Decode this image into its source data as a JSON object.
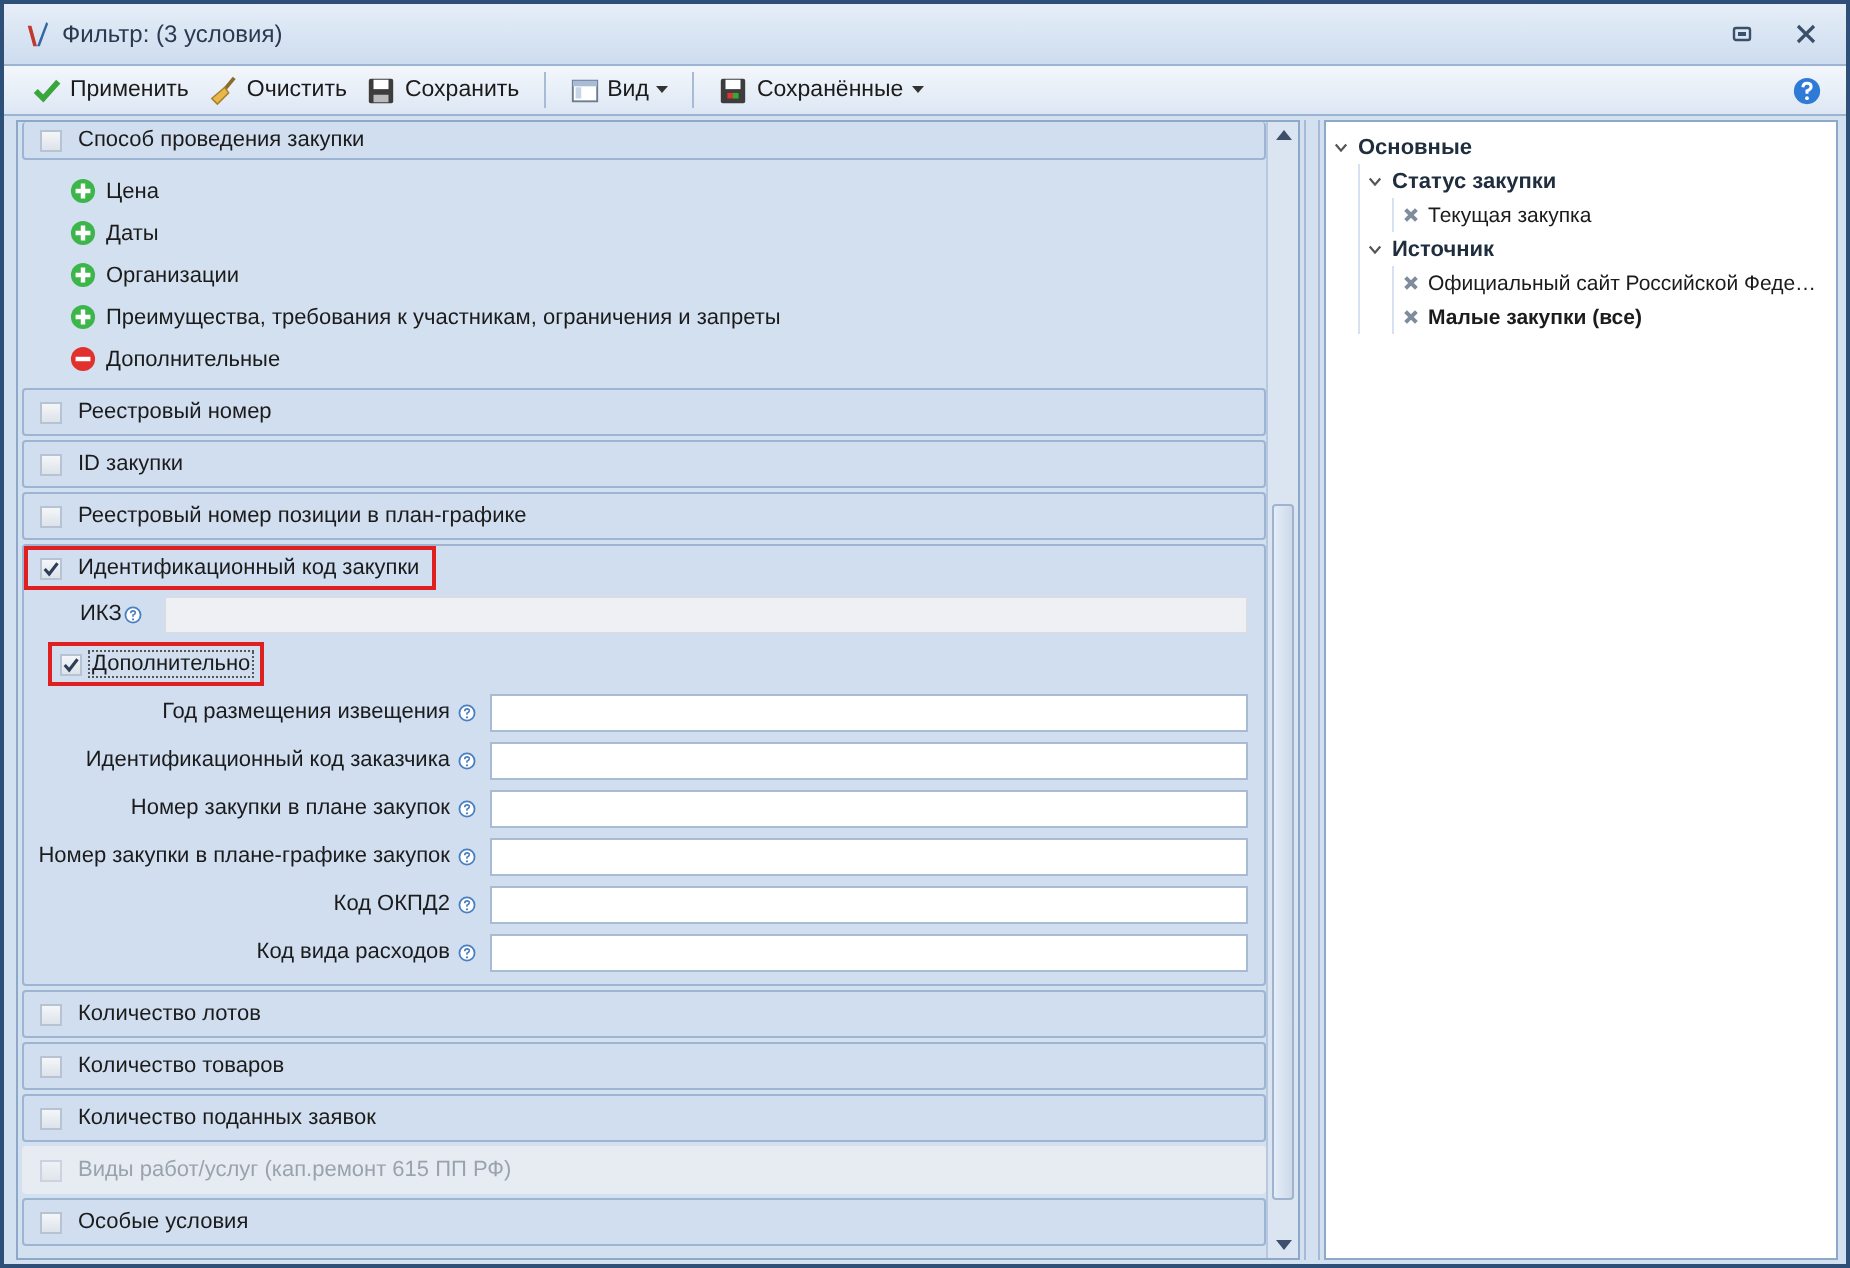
{
  "window": {
    "title": "Фильтр: (3 условия)"
  },
  "toolbar": [
    {
      "label": "Применить",
      "kind": "apply",
      "dropdown": false
    },
    {
      "label": "Очистить",
      "kind": "clear",
      "dropdown": false
    },
    {
      "label": "Сохранить",
      "kind": "save",
      "dropdown": false
    },
    {
      "label": "Вид",
      "kind": "view",
      "dropdown": true
    },
    {
      "label": "Сохранённые",
      "kind": "saved",
      "dropdown": true
    }
  ],
  "filters": [
    {
      "kind": "section",
      "label": "Способ проведения закупки",
      "checked": false,
      "disabled": false,
      "highlighted": false
    },
    {
      "kind": "groups",
      "groups": [
        {
          "label": "Цена",
          "expanded": false
        },
        {
          "label": "Даты",
          "expanded": false
        },
        {
          "label": "Организации",
          "expanded": false
        },
        {
          "label": "Преимущества, требования к участникам, ограничения и запреты",
          "expanded": false
        },
        {
          "label": "Дополнительные",
          "expanded": true
        }
      ]
    },
    {
      "kind": "section",
      "label": "Реестровый номер",
      "checked": false,
      "disabled": false,
      "highlighted": false
    },
    {
      "kind": "section",
      "label": "ID закупки",
      "checked": false,
      "disabled": false,
      "highlighted": false
    },
    {
      "kind": "section",
      "label": "Реестровый номер позиции в план-графике",
      "checked": false,
      "disabled": false,
      "highlighted": false
    },
    {
      "kind": "section",
      "label": "Идентификационный код закупки",
      "checked": true,
      "disabled": false,
      "highlighted": true,
      "main_field": {
        "label": "ИКЗ"
      },
      "extra": {
        "label": "Дополнительно",
        "checked": true,
        "highlighted": true
      },
      "fields": [
        {
          "label": "Год размещения извещения"
        },
        {
          "label": "Идентификационный код заказчика"
        },
        {
          "label": "Номер закупки в плане закупок"
        },
        {
          "label": "Номер закупки в плане-графике закупок"
        },
        {
          "label": "Код ОКПД2"
        },
        {
          "label": "Код вида расходов"
        }
      ]
    },
    {
      "kind": "section",
      "label": "Количество лотов",
      "checked": false,
      "disabled": false,
      "highlighted": false
    },
    {
      "kind": "section",
      "label": "Количество товаров",
      "checked": false,
      "disabled": false,
      "highlighted": false
    },
    {
      "kind": "section",
      "label": "Количество поданных заявок",
      "checked": false,
      "disabled": false,
      "highlighted": false
    },
    {
      "kind": "section",
      "label": "Виды работ/услуг (кап.ремонт 615 ПП РФ)",
      "checked": false,
      "disabled": true,
      "highlighted": false
    },
    {
      "kind": "section",
      "label": "Особые условия",
      "checked": false,
      "disabled": false,
      "highlighted": false
    }
  ],
  "summary": [
    {
      "label": "Основные",
      "expanded": true,
      "children": [
        {
          "label": "Статус закупки",
          "expanded": true,
          "children": [
            {
              "label": "Текущая закупка",
              "bold": false
            }
          ]
        },
        {
          "label": "Источник",
          "expanded": true,
          "children": [
            {
              "label": "Официальный сайт Российской Феде…",
              "bold": false
            },
            {
              "label": "Малые закупки (все)",
              "bold": true
            }
          ]
        }
      ]
    }
  ]
}
